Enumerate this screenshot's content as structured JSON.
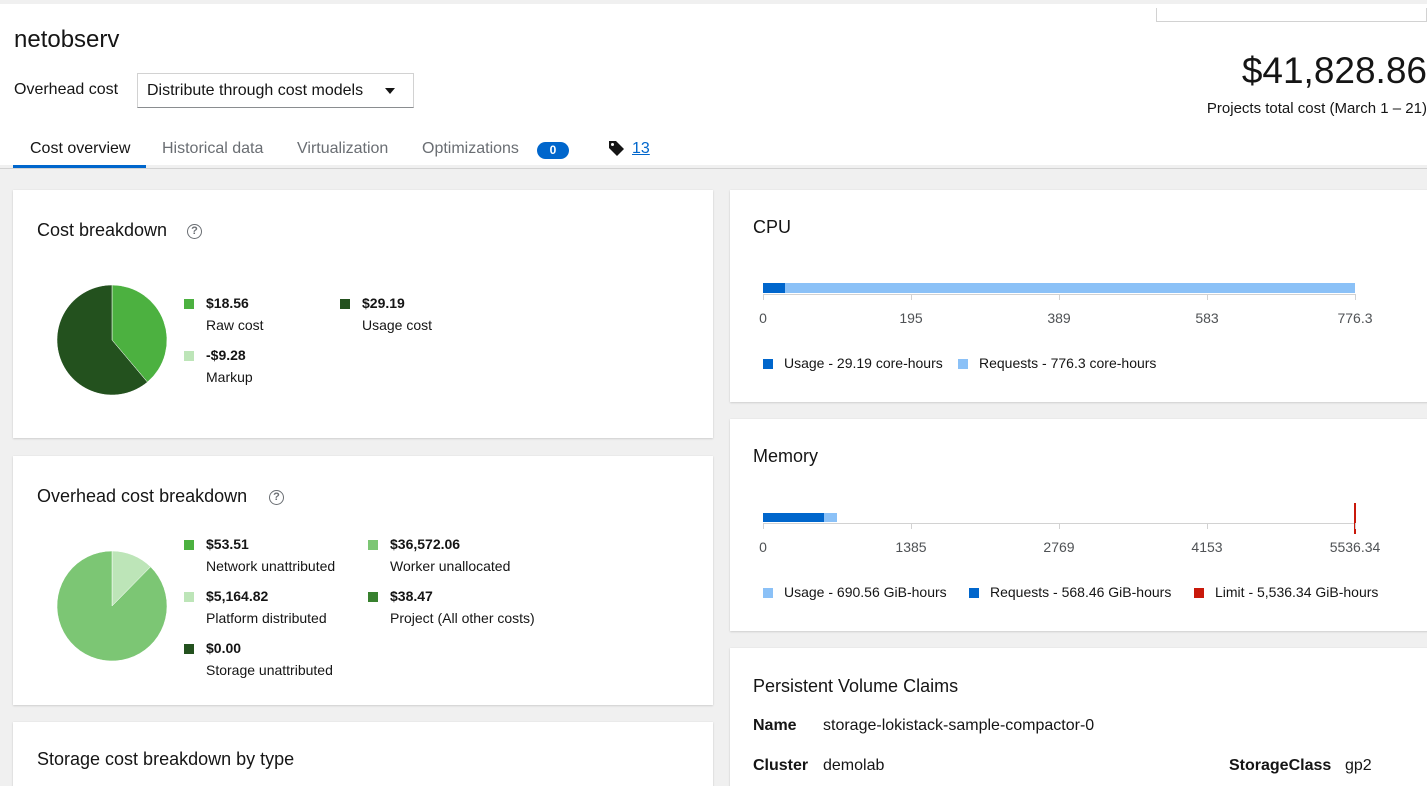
{
  "header": {
    "title": "netobserv",
    "overhead_label": "Overhead cost",
    "overhead_select": "Distribute through cost models",
    "total_cost": "$41,828.86",
    "total_subtitle": "Projects total cost (March 1 – 21)"
  },
  "tabs": [
    {
      "label": "Cost overview",
      "active": true
    },
    {
      "label": "Historical data"
    },
    {
      "label": "Virtualization"
    },
    {
      "label": "Optimizations",
      "badge": "0"
    }
  ],
  "tags_link": "13",
  "cost_breakdown": {
    "title": "Cost breakdown",
    "legend": [
      {
        "value": "$18.56",
        "label": "Raw cost",
        "color": "#4cb140"
      },
      {
        "value": "$29.19",
        "label": "Usage cost",
        "color": "#23511e"
      },
      {
        "value": "-$9.28",
        "label": "Markup",
        "color": "#bde5b8"
      }
    ],
    "pie": [
      {
        "name": "Raw cost",
        "value": 18.56,
        "color": "#4cb140"
      },
      {
        "name": "Usage cost",
        "value": 29.19,
        "color": "#23511e"
      }
    ]
  },
  "overhead_breakdown": {
    "title": "Overhead cost breakdown",
    "legend": [
      {
        "value": "$53.51",
        "label": "Network unattributed",
        "color": "#4cb140"
      },
      {
        "value": "$36,572.06",
        "label": "Worker unallocated",
        "color": "#7cc674"
      },
      {
        "value": "$5,164.82",
        "label": "Platform distributed",
        "color": "#bde5b8"
      },
      {
        "value": "$38.47",
        "label": "Project (All other costs)",
        "color": "#38812f"
      },
      {
        "value": "$0.00",
        "label": "Storage unattributed",
        "color": "#23511e"
      }
    ],
    "pie": [
      {
        "name": "Platform distributed",
        "value": 5164.82,
        "color": "#bde5b8"
      },
      {
        "name": "Worker unallocated",
        "value": 36572.06,
        "color": "#7cc674"
      }
    ]
  },
  "storage_breakdown": {
    "title": "Storage cost breakdown by type"
  },
  "cpu": {
    "title": "CPU",
    "max": 776.3,
    "usage": 29.19,
    "requests": 776.3,
    "ticks": [
      "0",
      "195",
      "389",
      "583",
      "776.3"
    ],
    "legend": [
      {
        "label": "Usage - 29.19 core-hours",
        "color": "#06c"
      },
      {
        "label": "Requests - 776.3 core-hours",
        "color": "#8bc1f7"
      }
    ]
  },
  "memory": {
    "title": "Memory",
    "max": 5536.34,
    "usage": 690.56,
    "requests": 568.46,
    "limit": 5536.34,
    "ticks": [
      "0",
      "1385",
      "2769",
      "4153",
      "5536.34"
    ],
    "legend": [
      {
        "label": "Usage - 690.56 GiB-hours",
        "color": "#8bc1f7"
      },
      {
        "label": "Requests - 568.46 GiB-hours",
        "color": "#06c"
      },
      {
        "label": "Limit - 5,536.34 GiB-hours",
        "color": "#c9190b"
      }
    ]
  },
  "pvc": {
    "title": "Persistent Volume Claims",
    "name_key": "Name",
    "name_val": "storage-lokistack-sample-compactor-0",
    "cluster_key": "Cluster",
    "cluster_val": "demolab",
    "storageclass_key": "StorageClass",
    "storageclass_val": "gp2"
  }
}
